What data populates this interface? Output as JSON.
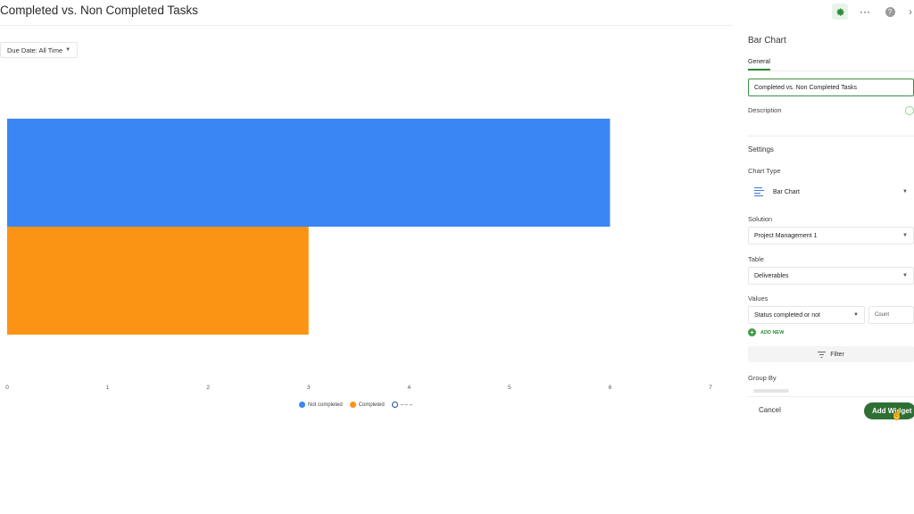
{
  "header": {
    "title": "Completed vs. Non Completed Tasks",
    "icons": [
      "gear-icon",
      "more-icon",
      "help-icon",
      "close-icon"
    ],
    "more_glyph": "···",
    "help_glyph": "?",
    "close_glyph": "›"
  },
  "filter": {
    "label": "Due Date: All Time"
  },
  "chart_data": {
    "type": "bar",
    "orientation": "horizontal",
    "series": [
      {
        "name": "Not completed",
        "values": [
          6
        ],
        "color": "#3b86f5"
      },
      {
        "name": "Completed",
        "values": [
          3
        ],
        "color": "#fb9414"
      },
      {
        "name": "– – –",
        "values": [],
        "color": "#1f4f8f"
      }
    ],
    "xticks": [
      "0",
      "1",
      "2",
      "3",
      "4",
      "5",
      "6",
      "7"
    ],
    "xlim": [
      0,
      7
    ],
    "grid": false,
    "legend_position": "bottom"
  },
  "panel": {
    "title": "Bar Chart",
    "tab": "General",
    "name_value": "Completed vs. Non Completed Tasks",
    "description_label": "Description",
    "settings_title": "Settings",
    "chart_type_label": "Chart Type",
    "chart_type_value": "Bar Chart",
    "solution_label": "Solution",
    "solution_value": "Project Management 1",
    "table_label": "Table",
    "table_value": "Deliverables",
    "values_label": "Values",
    "values_field": "Status completed or not",
    "values_agg": "Count",
    "add_new": "ADD NEW",
    "filter_btn": "Filter",
    "group_by_label": "Group By",
    "cancel": "Cancel",
    "add_widget": "Add Widget"
  },
  "colors": {
    "accent": "#2e8b3a",
    "primary_button": "#2f6f34"
  }
}
